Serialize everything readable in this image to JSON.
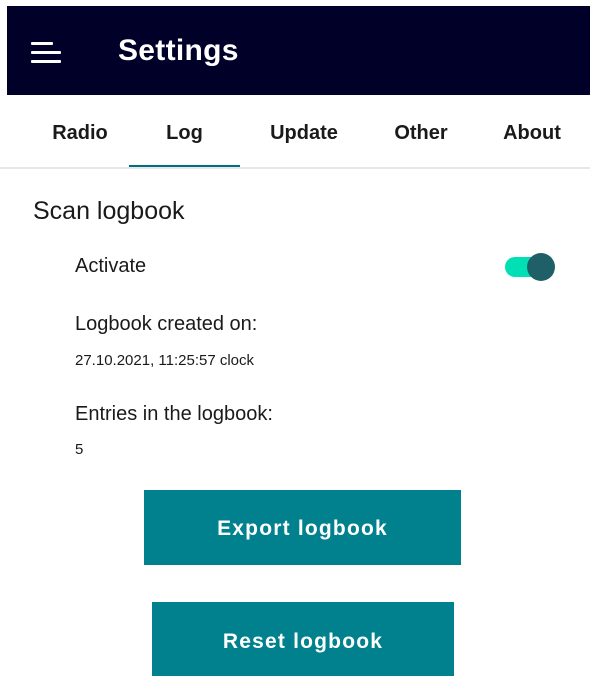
{
  "header": {
    "title": "Settings",
    "menu_icon": "hamburger-menu-icon"
  },
  "tabs": [
    {
      "label": "Radio",
      "active": false
    },
    {
      "label": "Log",
      "active": true
    },
    {
      "label": "Update",
      "active": false
    },
    {
      "label": "Other",
      "active": false
    },
    {
      "label": "About",
      "active": false
    }
  ],
  "scan_logbook": {
    "title": "Scan logbook",
    "activate_label": "Activate",
    "activate_on": true,
    "created_label": "Logbook created on:",
    "created_value": "27.10.2021, 11:25:57 clock",
    "entries_label": "Entries in the logbook:",
    "entries_value": "5"
  },
  "actions": {
    "export_label": "Export logbook",
    "reset_label": "Reset logbook"
  },
  "colors": {
    "app_bar": "#000028",
    "accent": "#00818d",
    "tab_indicator": "#00707f",
    "toggle_track": "#00e0b4",
    "toggle_thumb": "#1f6068"
  }
}
